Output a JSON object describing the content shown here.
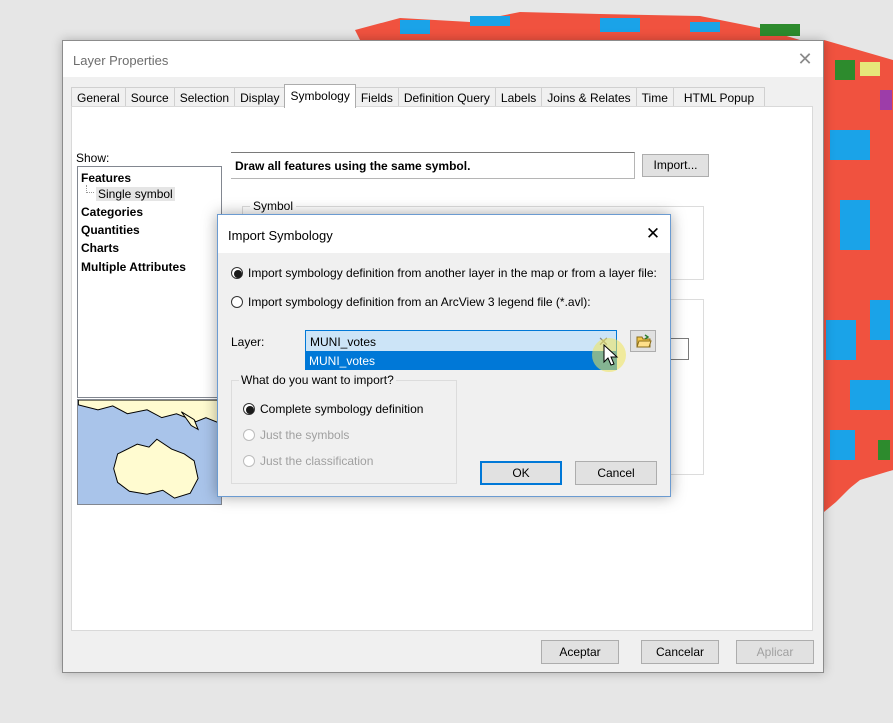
{
  "colors": {
    "accent": "#0078d7",
    "map_red": "#f0523f",
    "map_blue": "#1aa3e8",
    "map_green": "#2d8b2d"
  },
  "layer_properties": {
    "title": "Layer Properties",
    "close_icon": "close-icon",
    "tabs": [
      "General",
      "Source",
      "Selection",
      "Display",
      "Symbology",
      "Fields",
      "Definition Query",
      "Labels",
      "Joins & Relates",
      "Time",
      "HTML Popup"
    ],
    "active_tab": "Symbology",
    "show_label": "Show:",
    "tree": {
      "features": "Features",
      "single_symbol": "Single symbol",
      "categories": "Categories",
      "quantities": "Quantities",
      "charts": "Charts",
      "multiple_attributes": "Multiple Attributes"
    },
    "description": "Draw all features using the same symbol.",
    "import_label": "Import...",
    "symbol_group_label": "Symbol",
    "buttons": {
      "accept": "Aceptar",
      "cancel": "Cancelar",
      "apply": "Aplicar"
    }
  },
  "import_dialog": {
    "title": "Import Symbology",
    "option_layer": "Import symbology definition from another layer in the map or from a layer file:",
    "option_avl": "Import symbology definition from an ArcView 3 legend file (*.avl):",
    "layer_label": "Layer:",
    "layer_value": "MUNI_votes",
    "dropdown_option": "MUNI_votes",
    "what_label": "What do you want to import?",
    "import_options": [
      "Complete symbology definition",
      "Just the symbols",
      "Just the classification"
    ],
    "ok_label": "OK",
    "cancel_label": "Cancel",
    "browse_icon": "folder-open-icon"
  }
}
